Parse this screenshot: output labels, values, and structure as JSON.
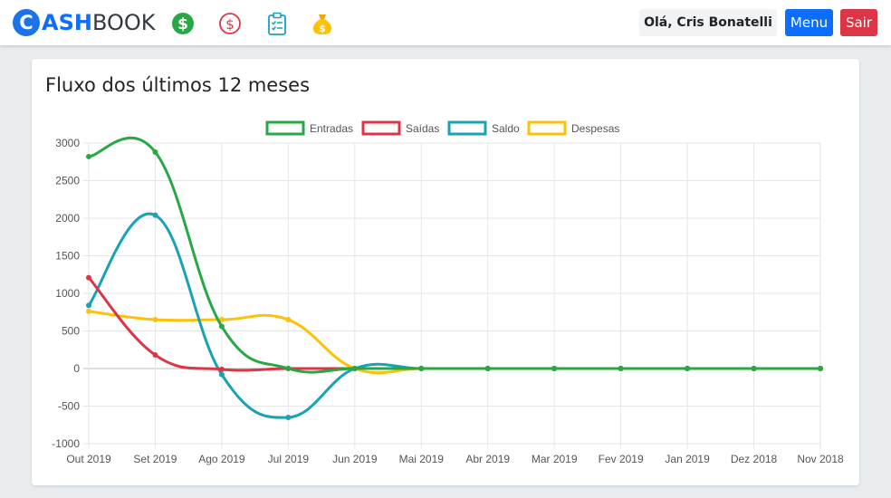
{
  "navbar": {
    "brand_letter": "C",
    "brand_bold": "ASH",
    "brand_rest": "BOOK",
    "icons": [
      "dollar-circle-icon",
      "dollar-outline-icon",
      "clipboard-icon",
      "money-bag-icon"
    ],
    "greeting": "Olá, Cris Bonatelli",
    "menu_label": "Menu",
    "logout_label": "Sair"
  },
  "card": {
    "title": "Fluxo dos últimos 12 meses"
  },
  "colors": {
    "entradas": "#28a745",
    "saidas": "#dc3545",
    "saldo": "#17a2b8",
    "despesas": "#ffc107"
  },
  "chart_data": {
    "type": "line",
    "title": "",
    "xlabel": "",
    "ylabel": "",
    "categories": [
      "Out 2019",
      "Set 2019",
      "Ago 2019",
      "Jul 2019",
      "Jun 2019",
      "Mai 2019",
      "Abr 2019",
      "Mar 2019",
      "Fev 2019",
      "Jan 2019",
      "Dez 2018",
      "Nov 2018"
    ],
    "ylim": [
      -1000,
      3000
    ],
    "yticks": [
      -1000,
      -500,
      0,
      500,
      1000,
      1500,
      2000,
      2500,
      3000
    ],
    "legend_position": "top",
    "grid": true,
    "series": [
      {
        "name": "Entradas",
        "color": "#28a745",
        "values": [
          2820,
          2880,
          560,
          0,
          0,
          0,
          0,
          0,
          0,
          0,
          0,
          0
        ]
      },
      {
        "name": "Saídas",
        "color": "#dc3545",
        "values": [
          1210,
          180,
          -10,
          0,
          0,
          0,
          0,
          0,
          0,
          0,
          0,
          0
        ]
      },
      {
        "name": "Saldo",
        "color": "#17a2b8",
        "values": [
          840,
          2040,
          -80,
          -650,
          0,
          0,
          0,
          0,
          0,
          0,
          0,
          0
        ]
      },
      {
        "name": "Despesas",
        "color": "#ffc107",
        "values": [
          760,
          650,
          650,
          650,
          0,
          0,
          0,
          0,
          0,
          0,
          0,
          0
        ]
      }
    ]
  }
}
